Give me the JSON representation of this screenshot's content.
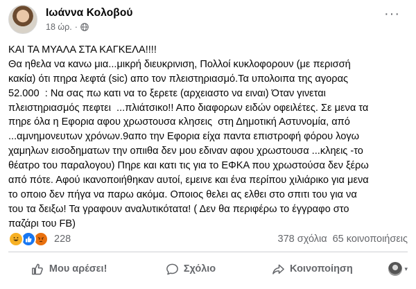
{
  "post": {
    "author": "Ιωάννα Κολοβού",
    "time": "18 ώρ.",
    "separator": "·",
    "privacy_icon": "globe-icon",
    "more_icon": "more-options-icon",
    "more_label": "···",
    "lines": [
      "ΚΑΙ ΤΑ ΜΥΑΛΑ ΣΤΑ ΚΑΓΚΕΛΑ!!!!",
      "Θα ηθελα να κανω μια...μικρή διευκρινιση, Πολλοί κυκλοφορουν (με περισσή",
      "κακία) ότι πηρα λεφτά (sic) απο τον πλειστηριασμό.Τα υπολοιπα της αγορας",
      "52.000  : Να σας πω κατι να το ξερετε (αρχειαστο να ειναι) Όταν γινεται",
      "πλειστηριασμός πεφτει  ...πλιάτσικο!! Απο διαφορων ειδών οφειλέτες. Σε μενα τα",
      "πηρε όλα η Εφορια αφου χρωστουσα κλησεις  στη Δημοτική Αστυνομία, από",
      "...αμνημονευτων χρόνων.9απο την Εφορια είχα παντα επιστροφή φόρου λογω",
      "χαμηλων εισοδηματων την οπιιθα δεν μου εδιναν αφου χρωστουσα ...κληεις -το",
      "θέατρο του παραλογου) Πηρε και κατι τις για το ΕΦΚΑ που χρωστούσα δεν ξέρω",
      "από πότε. Αφού ικανοποιήθηκαν αυτοί, εμεινε και ένα περίπου χιλιάρικο για μενα",
      "το οποιο δεν πήγα να παρω ακόμα. Οποιος θελει ας ελθει στο σπιτι του για να",
      "του τα δειξω! Τα γραφουν αναλυτικότατα! ( Δεν θα περιφέρω το έγγραφο στο",
      "παζάρι του FB)"
    ]
  },
  "stats": {
    "reaction_icons": [
      "haha-reaction-icon",
      "like-reaction-icon",
      "angry-reaction-icon"
    ],
    "reaction_count": "228",
    "comments": "378 σχόλια",
    "shares": "65 κοινοποιήσεις"
  },
  "actions": {
    "like_label": "Μου αρέσει!",
    "comment_label": "Σχόλιο",
    "share_label": "Κοινοποίηση",
    "caret": "▾"
  },
  "colors": {
    "text": "#050505",
    "secondary": "#65676b",
    "like_blue": "#1877f2",
    "haha_yellow": "#f7b125",
    "angry_orange": "#e9710f",
    "divider": "#ced0d4"
  }
}
